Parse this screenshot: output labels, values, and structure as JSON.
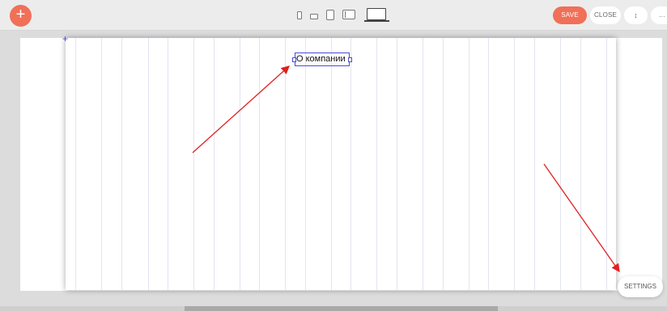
{
  "toolbar": {
    "add_label": "+",
    "save_label": "SAVE",
    "close_label": "CLOSE",
    "order_label": "↕",
    "more_label": "..."
  },
  "devices": [
    "phone-portrait-icon",
    "phone-landscape-icon",
    "tablet-portrait-icon",
    "tablet-landscape-icon",
    "laptop-icon"
  ],
  "canvas": {
    "text_element": "О компании",
    "marker": "+"
  },
  "settings_label": "SETTINGS",
  "colors": {
    "accent": "#f07058",
    "selection": "#4b4bd6",
    "annotation_arrow": "#e02020"
  }
}
